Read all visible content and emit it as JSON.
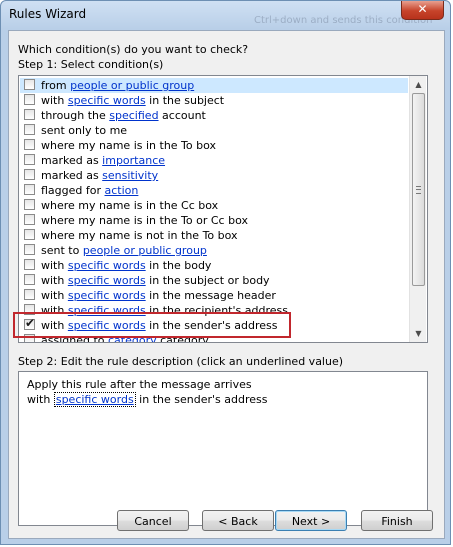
{
  "window": {
    "title": "Rules Wizard",
    "background_title": "Ctrl+down and sends this condition",
    "close_glyph": "✕"
  },
  "header": {
    "question": "Which condition(s) do you want to check?",
    "step1_label": "Step 1: Select condition(s)"
  },
  "conditions": [
    {
      "checked": false,
      "selected": true,
      "pre": "from ",
      "link": "people or public group",
      "post": ""
    },
    {
      "checked": false,
      "selected": false,
      "pre": "with ",
      "link": "specific words",
      "post": " in the subject"
    },
    {
      "checked": false,
      "selected": false,
      "pre": "through the ",
      "link": "specified",
      "post": " account"
    },
    {
      "checked": false,
      "selected": false,
      "pre": "sent only to me",
      "link": "",
      "post": ""
    },
    {
      "checked": false,
      "selected": false,
      "pre": "where my name is in the To box",
      "link": "",
      "post": ""
    },
    {
      "checked": false,
      "selected": false,
      "pre": "marked as ",
      "link": "importance",
      "post": ""
    },
    {
      "checked": false,
      "selected": false,
      "pre": "marked as ",
      "link": "sensitivity",
      "post": ""
    },
    {
      "checked": false,
      "selected": false,
      "pre": "flagged for ",
      "link": "action",
      "post": ""
    },
    {
      "checked": false,
      "selected": false,
      "pre": "where my name is in the Cc box",
      "link": "",
      "post": ""
    },
    {
      "checked": false,
      "selected": false,
      "pre": "where my name is in the To or Cc box",
      "link": "",
      "post": ""
    },
    {
      "checked": false,
      "selected": false,
      "pre": "where my name is not in the To box",
      "link": "",
      "post": ""
    },
    {
      "checked": false,
      "selected": false,
      "pre": "sent to ",
      "link": "people or public group",
      "post": ""
    },
    {
      "checked": false,
      "selected": false,
      "pre": "with ",
      "link": "specific words",
      "post": " in the body"
    },
    {
      "checked": false,
      "selected": false,
      "pre": "with ",
      "link": "specific words",
      "post": " in the subject or body"
    },
    {
      "checked": false,
      "selected": false,
      "pre": "with ",
      "link": "specific words",
      "post": " in the message header"
    },
    {
      "checked": false,
      "selected": false,
      "pre": "with ",
      "link": "specific words",
      "post": " in the recipient's address"
    },
    {
      "checked": true,
      "selected": false,
      "pre": "with ",
      "link": "specific words",
      "post": " in the sender's address"
    },
    {
      "checked": false,
      "selected": false,
      "pre": "assigned to ",
      "link": "category",
      "post": " category"
    }
  ],
  "step2": {
    "label": "Step 2: Edit the rule description (click an underlined value)",
    "line1": "Apply this rule after the message arrives",
    "line2_pre": "with ",
    "line2_link": "specific words",
    "line2_post": " in the sender's address"
  },
  "buttons": {
    "cancel": "Cancel",
    "back": "< Back",
    "next": "Next >",
    "finish": "Finish"
  },
  "scrollbar": {
    "up_glyph": "▲",
    "down_glyph": "▼"
  }
}
